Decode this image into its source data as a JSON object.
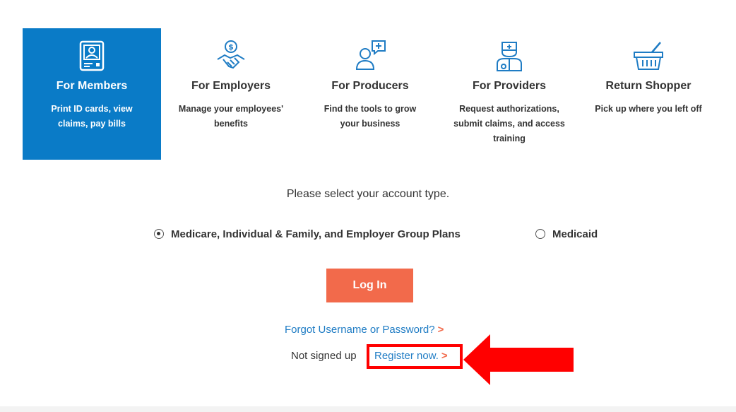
{
  "tiles": [
    {
      "title": "For Members",
      "desc": "Print ID cards, view claims, pay bills",
      "icon": "member-id-card-icon",
      "active": true
    },
    {
      "title": "For Employers",
      "desc": "Manage your employees' benefits",
      "icon": "handshake-dollar-icon",
      "active": false
    },
    {
      "title": "For Producers",
      "desc": "Find the tools to grow your business",
      "icon": "person-chat-plus-icon",
      "active": false
    },
    {
      "title": "For Providers",
      "desc": "Request authorizations, submit claims, and access training",
      "icon": "doctor-icon",
      "active": false
    },
    {
      "title": "Return Shopper",
      "desc": "Pick up where you left off",
      "icon": "shopping-basket-icon",
      "active": false
    }
  ],
  "prompt": "Please select your account type.",
  "account_types": [
    {
      "label": "Medicare, Individual & Family, and Employer Group Plans",
      "selected": true
    },
    {
      "label": "Medicaid",
      "selected": false
    }
  ],
  "login_label": "Log In",
  "forgot_label": "Forgot Username or Password?",
  "signup_prefix": "Not signed up",
  "register_label": "Register now.",
  "chevron": ">",
  "colors": {
    "brand_blue": "#0a7bc7",
    "accent_orange": "#f26a4b",
    "link_blue": "#1f7cc4",
    "annotation_red": "#ff0000"
  }
}
